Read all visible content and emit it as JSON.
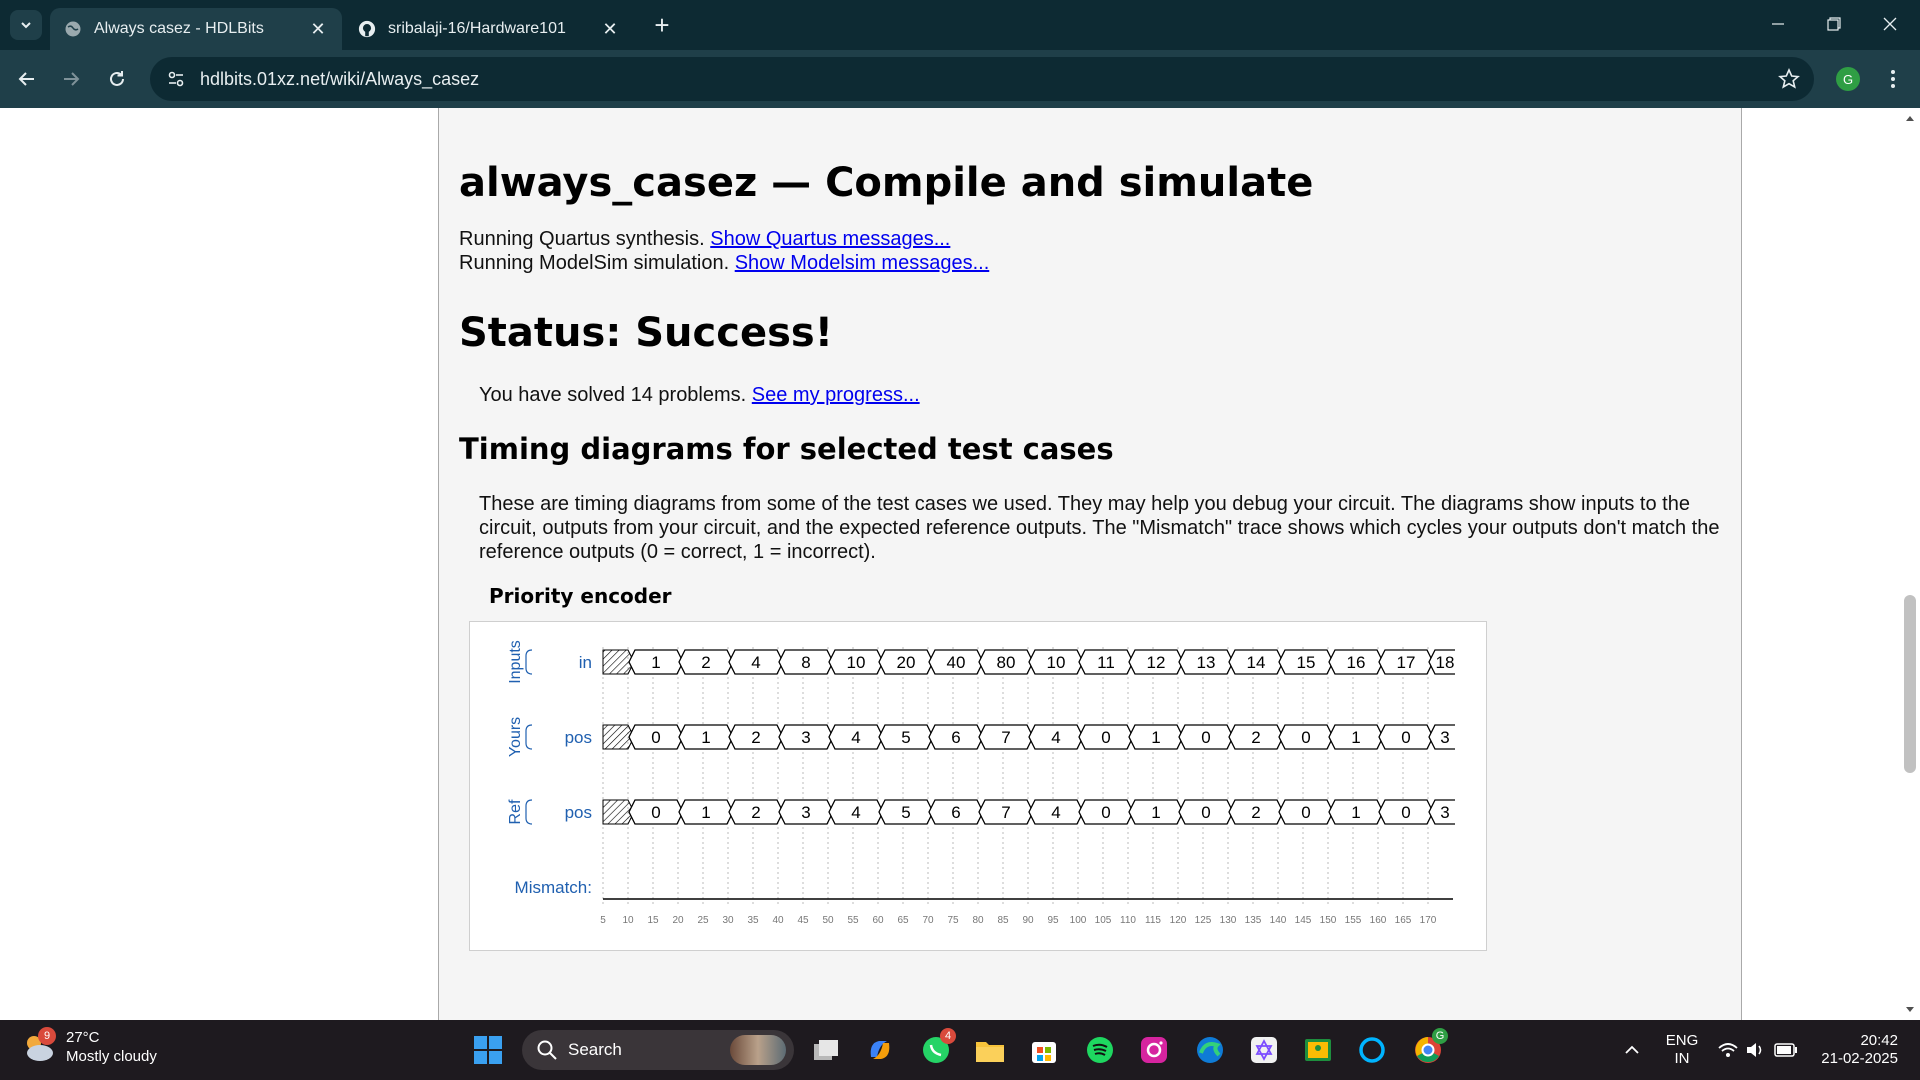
{
  "browser": {
    "tabs": [
      {
        "title": "Always casez - HDLBits",
        "active": true
      },
      {
        "title": "sribalaji-16/Hardware101",
        "active": false
      }
    ],
    "url": "hdlbits.01xz.net/wiki/Always_casez"
  },
  "page": {
    "heading": "always_casez — Compile and simulate",
    "quartus_text": "Running Quartus synthesis.",
    "quartus_link": "Show Quartus messages...",
    "modelsim_text": "Running ModelSim simulation.",
    "modelsim_link": "Show Modelsim messages...",
    "status_heading": "Status: Success!",
    "solved_text": "You have solved 14 problems.",
    "progress_link": "See my progress...",
    "timing_heading": "Timing diagrams for selected test cases",
    "timing_para": "These are timing diagrams from some of the test cases we used. They may help you debug your circuit. The diagrams show inputs to the circuit, outputs from your circuit, and the expected reference outputs. The \"Mismatch\" trace shows which cycles your outputs don't match the reference outputs (0 = correct, 1 = incorrect).",
    "diagram_title": "Priority encoder"
  },
  "chart_data": {
    "type": "timing",
    "groups": [
      {
        "group": "Inputs",
        "signal": "in",
        "values": [
          "1",
          "2",
          "4",
          "8",
          "10",
          "20",
          "40",
          "80",
          "10",
          "11",
          "12",
          "13",
          "14",
          "15",
          "16",
          "17",
          "18"
        ]
      },
      {
        "group": "Yours",
        "signal": "pos",
        "values": [
          "0",
          "1",
          "2",
          "3",
          "4",
          "5",
          "6",
          "7",
          "4",
          "0",
          "1",
          "0",
          "2",
          "0",
          "1",
          "0",
          "3"
        ]
      },
      {
        "group": "Ref",
        "signal": "pos",
        "values": [
          "0",
          "1",
          "2",
          "3",
          "4",
          "5",
          "6",
          "7",
          "4",
          "0",
          "1",
          "0",
          "2",
          "0",
          "1",
          "0",
          "3"
        ]
      }
    ],
    "mismatch_label": "Mismatch:",
    "mismatch": [
      0,
      0,
      0,
      0,
      0,
      0,
      0,
      0,
      0,
      0,
      0,
      0,
      0,
      0,
      0,
      0,
      0
    ],
    "time_ticks": [
      "5",
      "10",
      "15",
      "20",
      "25",
      "30",
      "35",
      "40",
      "45",
      "50",
      "55",
      "60",
      "65",
      "70",
      "75",
      "80",
      "85",
      "90",
      "95",
      "100",
      "105",
      "110",
      "115",
      "120",
      "125",
      "130",
      "135",
      "140",
      "145",
      "150",
      "155",
      "160",
      "165",
      "170"
    ],
    "colors": {
      "label": "#2060b0",
      "trace": "#000000",
      "grid": "#bbbbbb"
    }
  },
  "taskbar": {
    "weather_temp": "27°C",
    "weather_desc": "Mostly cloudy",
    "weather_badge": "9",
    "search_placeholder": "Search",
    "whatsapp_badge": "4",
    "lang_top": "ENG",
    "lang_bottom": "IN",
    "time": "20:42",
    "date": "21-02-2025",
    "profile_initial": "G"
  }
}
